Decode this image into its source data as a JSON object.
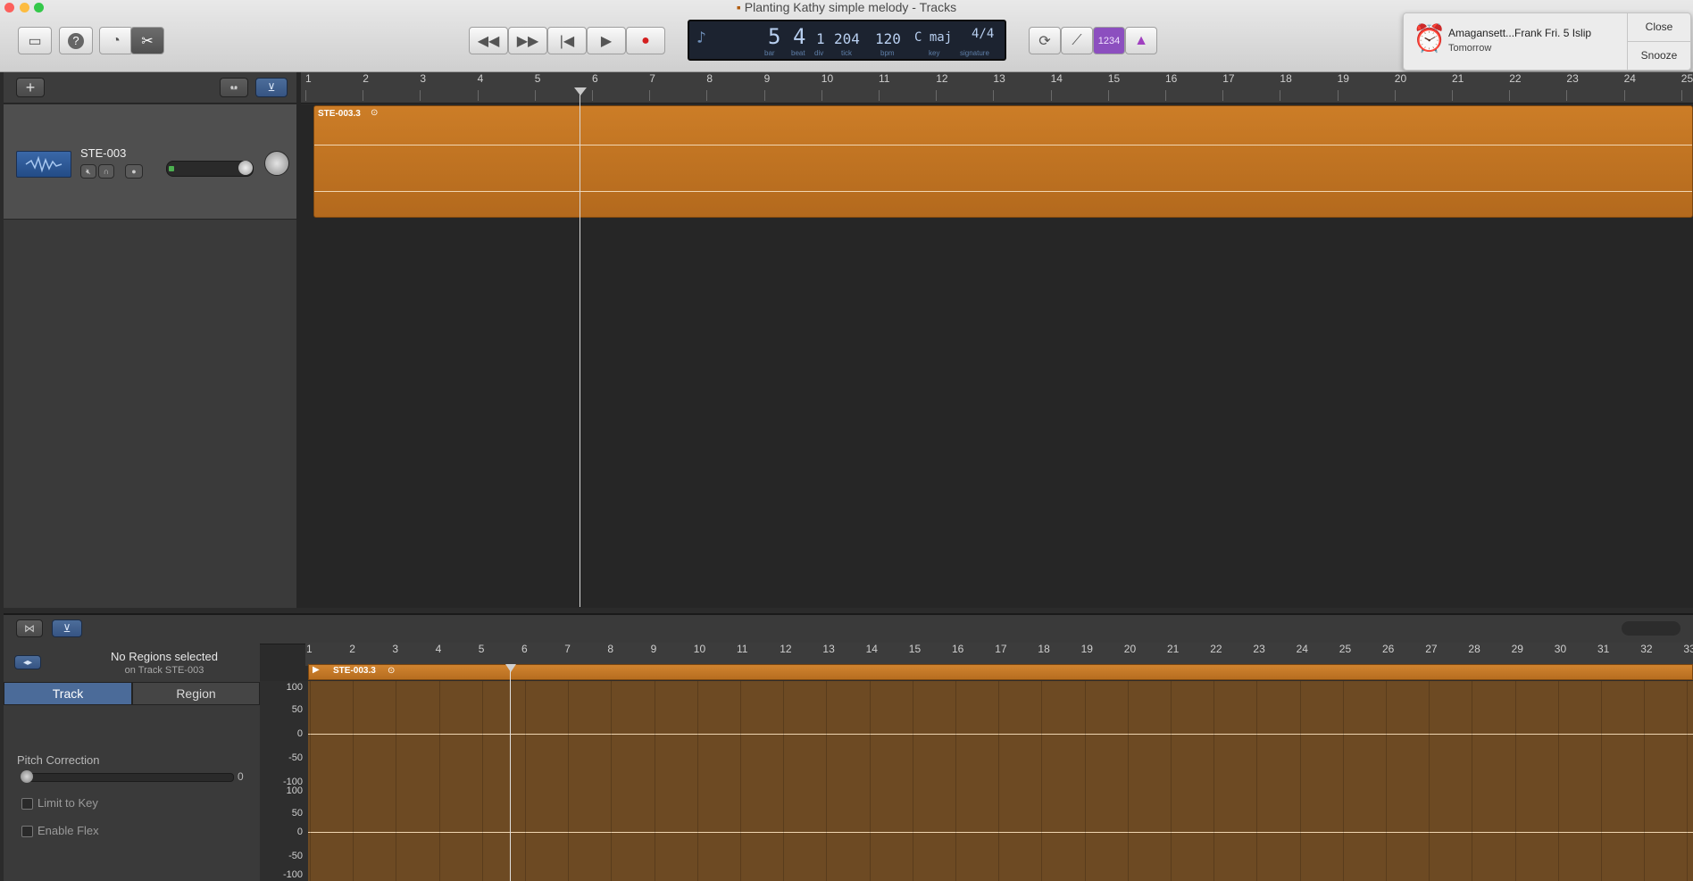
{
  "window": {
    "title": "Planting Kathy simple melody - Tracks"
  },
  "toolbar": {
    "library_icon": "library-icon",
    "help_label": "?",
    "lcd": {
      "bar": "5",
      "beat": "4",
      "div": "1",
      "tick": "204",
      "bpm": "120",
      "key": "C maj",
      "signature": "4/4",
      "labels": {
        "bar": "bar",
        "beat": "beat",
        "div": "div",
        "tick": "tick",
        "bpm": "bpm",
        "key": "key",
        "signature": "signature"
      }
    },
    "count_in_label": "1234"
  },
  "notification": {
    "title": "Amagansett...Frank Fri. 5 Islip",
    "subtitle": "Tomorrow",
    "close_label": "Close",
    "snooze_label": "Snooze"
  },
  "tracks_header": {
    "add_label": "+"
  },
  "ruler_top": {
    "bars": [
      "1",
      "2",
      "3",
      "4",
      "5",
      "6",
      "7",
      "8",
      "9",
      "10",
      "11",
      "12",
      "13",
      "14",
      "15",
      "16",
      "17",
      "18",
      "19",
      "20",
      "21",
      "22",
      "23",
      "24",
      "25"
    ]
  },
  "track": {
    "name": "STE-003"
  },
  "region": {
    "name": "STE-003.3"
  },
  "editor": {
    "inspector": {
      "title": "No Regions selected",
      "subtitle": "on Track STE-003",
      "tab_track": "Track",
      "tab_region": "Region",
      "pitch_correction_label": "Pitch Correction",
      "pitch_value": "0",
      "limit_to_key_label": "Limit to Key",
      "enable_flex_label": "Enable Flex"
    },
    "ruler_bars": [
      "1",
      "2",
      "3",
      "4",
      "5",
      "6",
      "7",
      "8",
      "9",
      "10",
      "11",
      "12",
      "13",
      "14",
      "15",
      "16",
      "17",
      "18",
      "19",
      "20",
      "21",
      "22",
      "23",
      "24",
      "25",
      "26",
      "27",
      "28",
      "29",
      "30",
      "31",
      "32",
      "33"
    ],
    "region_name": "STE-003.3",
    "scale_labels": [
      "100",
      "50",
      "0",
      "-50",
      "-100",
      "100",
      "50",
      "0",
      "-50",
      "-100"
    ]
  }
}
